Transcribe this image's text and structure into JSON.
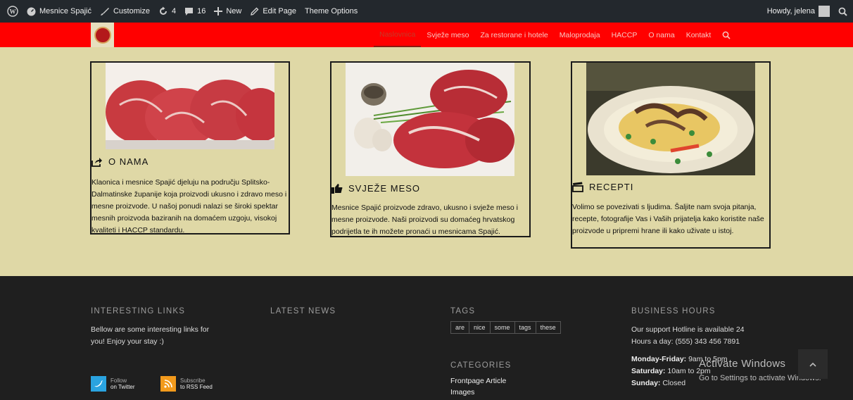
{
  "adminbar": {
    "site_name": "Mesnice Spajić",
    "customize": "Customize",
    "updates_count": "4",
    "comments_count": "16",
    "new_label": "New",
    "edit_page": "Edit Page",
    "theme_options": "Theme Options",
    "howdy": "Howdy, jelena"
  },
  "nav": {
    "items": [
      "Naslovnica",
      "Svježe meso",
      "Za restorane i hotele",
      "Maloprodaja",
      "HACCP",
      "O nama",
      "Kontakt"
    ],
    "active": "Naslovnica"
  },
  "cards": [
    {
      "title": "O NAMA",
      "text": "Klaonica i mesnice Spajić djeluju na području Splitsko-Dalmatinske županije koja proizvodi ukusno i zdravo meso i mesne proizvode. U našoj ponudi nalazi se široki spektar mesnih proizvoda baziranih na domaćem uzgoju, visokoj kvaliteti i HACCP standardu.",
      "icon": "share-arrow-icon"
    },
    {
      "title": "SVJEŽE MESO",
      "text": "Mesnice Spajić proizvode zdravo, ukusno i svježe meso i mesne proizvode. Naši proizvodi su domaćeg hrvatskog podrijetla te ih možete pronaći u mesnicama Spajić.",
      "icon": "thumbs-up-icon"
    },
    {
      "title": "RECEPTI",
      "text": "Volimo se povezivati s ljudima. Šaljite nam svoja pitanja, recepte, fotografije Vas i Vaših prijatelja kako koristite naše proizvode u pripremi hrane ili kako uživate u istoj.",
      "icon": "clapperboard-icon"
    }
  ],
  "footer": {
    "interesting": {
      "heading": "INTERESTING LINKS",
      "text": "Bellow are some interesting links for you! Enjoy your stay :)",
      "twitter_top": "Follow",
      "twitter_bottom": "on Twitter",
      "rss_top": "Subscribe",
      "rss_bottom": "to RSS Feed"
    },
    "news": {
      "heading": "LATEST NEWS"
    },
    "tags": {
      "heading": "TAGS",
      "items": [
        "are",
        "nice",
        "some",
        "tags",
        "these"
      ]
    },
    "categories": {
      "heading": "CATEGORIES",
      "items": [
        "Frontpage Article",
        "Images"
      ]
    },
    "hours": {
      "heading": "BUSINESS HOURS",
      "text": "Our support Hotline is available 24 Hours a day: (555) 343 456 7891",
      "rows": [
        {
          "label": "Monday-Friday:",
          "value": "9am to 5pm"
        },
        {
          "label": "Saturday:",
          "value": "10am to 2pm"
        },
        {
          "label": "Sunday:",
          "value": "Closed"
        }
      ]
    }
  },
  "activate": {
    "title": "Activate Windows",
    "subtitle": "Go to Settings to activate Windows."
  },
  "colors": {
    "adminbar": "#23282d",
    "header": "#ff0000",
    "content_bg": "#dfd8a6",
    "footer_bg": "#1f1f1f"
  }
}
